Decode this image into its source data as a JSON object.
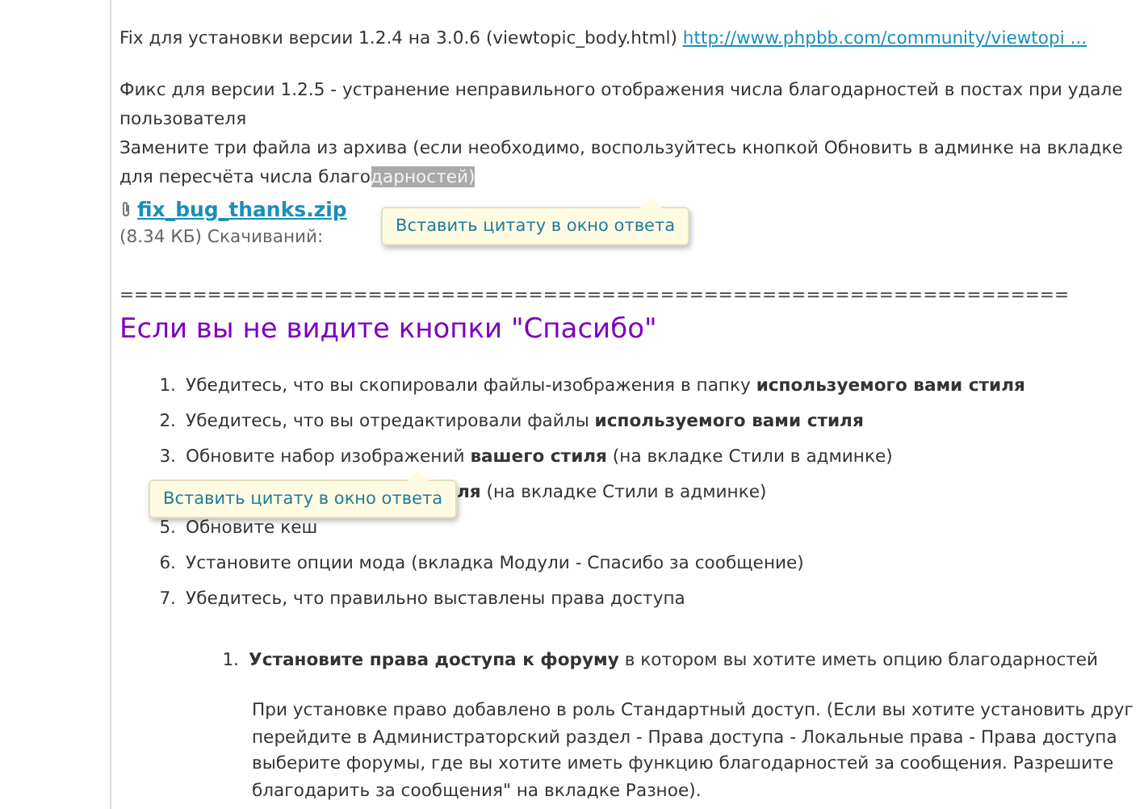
{
  "fix_note": {
    "text": "Fix для установки версии 1.2.4 на 3.0.6 (viewtopic_body.html)",
    "link": "http://www.phpbb.com/community/viewtopi ..."
  },
  "fix_description": [
    "Фикс для версии 1.2.5 - устранение неправильного отображения числа благодарностей в постах при удале",
    "пользователя",
    "Замените три файла из архива (если необходимо, воспользуйтесь кнопкой Обновить в админке на вкладке"
  ],
  "selection_line": {
    "text": "для пересчёта числа благо",
    "selected_text": "дарностей)"
  },
  "attachment": {
    "file_name": "fix_bug_thanks.zip",
    "info": "(8.34 КБ) Скачиваний:"
  },
  "separator": "=================================================================",
  "heading": "Если вы не видите кнопки \"Спасибо\"",
  "steps": [
    {
      "number": "1.",
      "text": "Убедитесь, что вы скопировали файлы-изображения в папку **используемого вами стиля**"
    },
    {
      "number": "2.",
      "text": "Убедитесь, что вы отредактировали файлы **используемого вами стиля**"
    },
    {
      "number": "3.",
      "text": "Обновите набор изображений **вашего стиля** (на вкладке Стили в админке)"
    },
    {
      "text": "**ля** (на вкладке Стили в админке)"
    },
    {
      "number": "5.",
      "text": "Обновите кеш"
    },
    {
      "number": "6.",
      "text": "Установите опции мода (вкладка Модули - Спасибо за сообщение)"
    },
    {
      "number": "7.",
      "text": "Убедитесь, что правильно выставлены права доступа"
    }
  ],
  "substeps": [
    {
      "number": "1.",
      "text": "**Установите права доступа к форуму** в котором вы хотите иметь опцию благодарностей"
    }
  ],
  "note_lines": [
    "При установке право добавлено в роль Стандартный доступ. (Если вы хотите установить друг",
    "перейдите в Администраторский раздел - Права доступа - Локальные права - Права доступа",
    "выберите форумы, где вы хотите иметь функцию благодарностей за сообщения. Разрешите",
    "благодарить за сообщения\" на вкладке Разное)."
  ],
  "tooltips": [
    {
      "text": "Вставить цитату в окно ответа"
    },
    {
      "text": "Вставить цитату в окно ответа"
    }
  ]
}
